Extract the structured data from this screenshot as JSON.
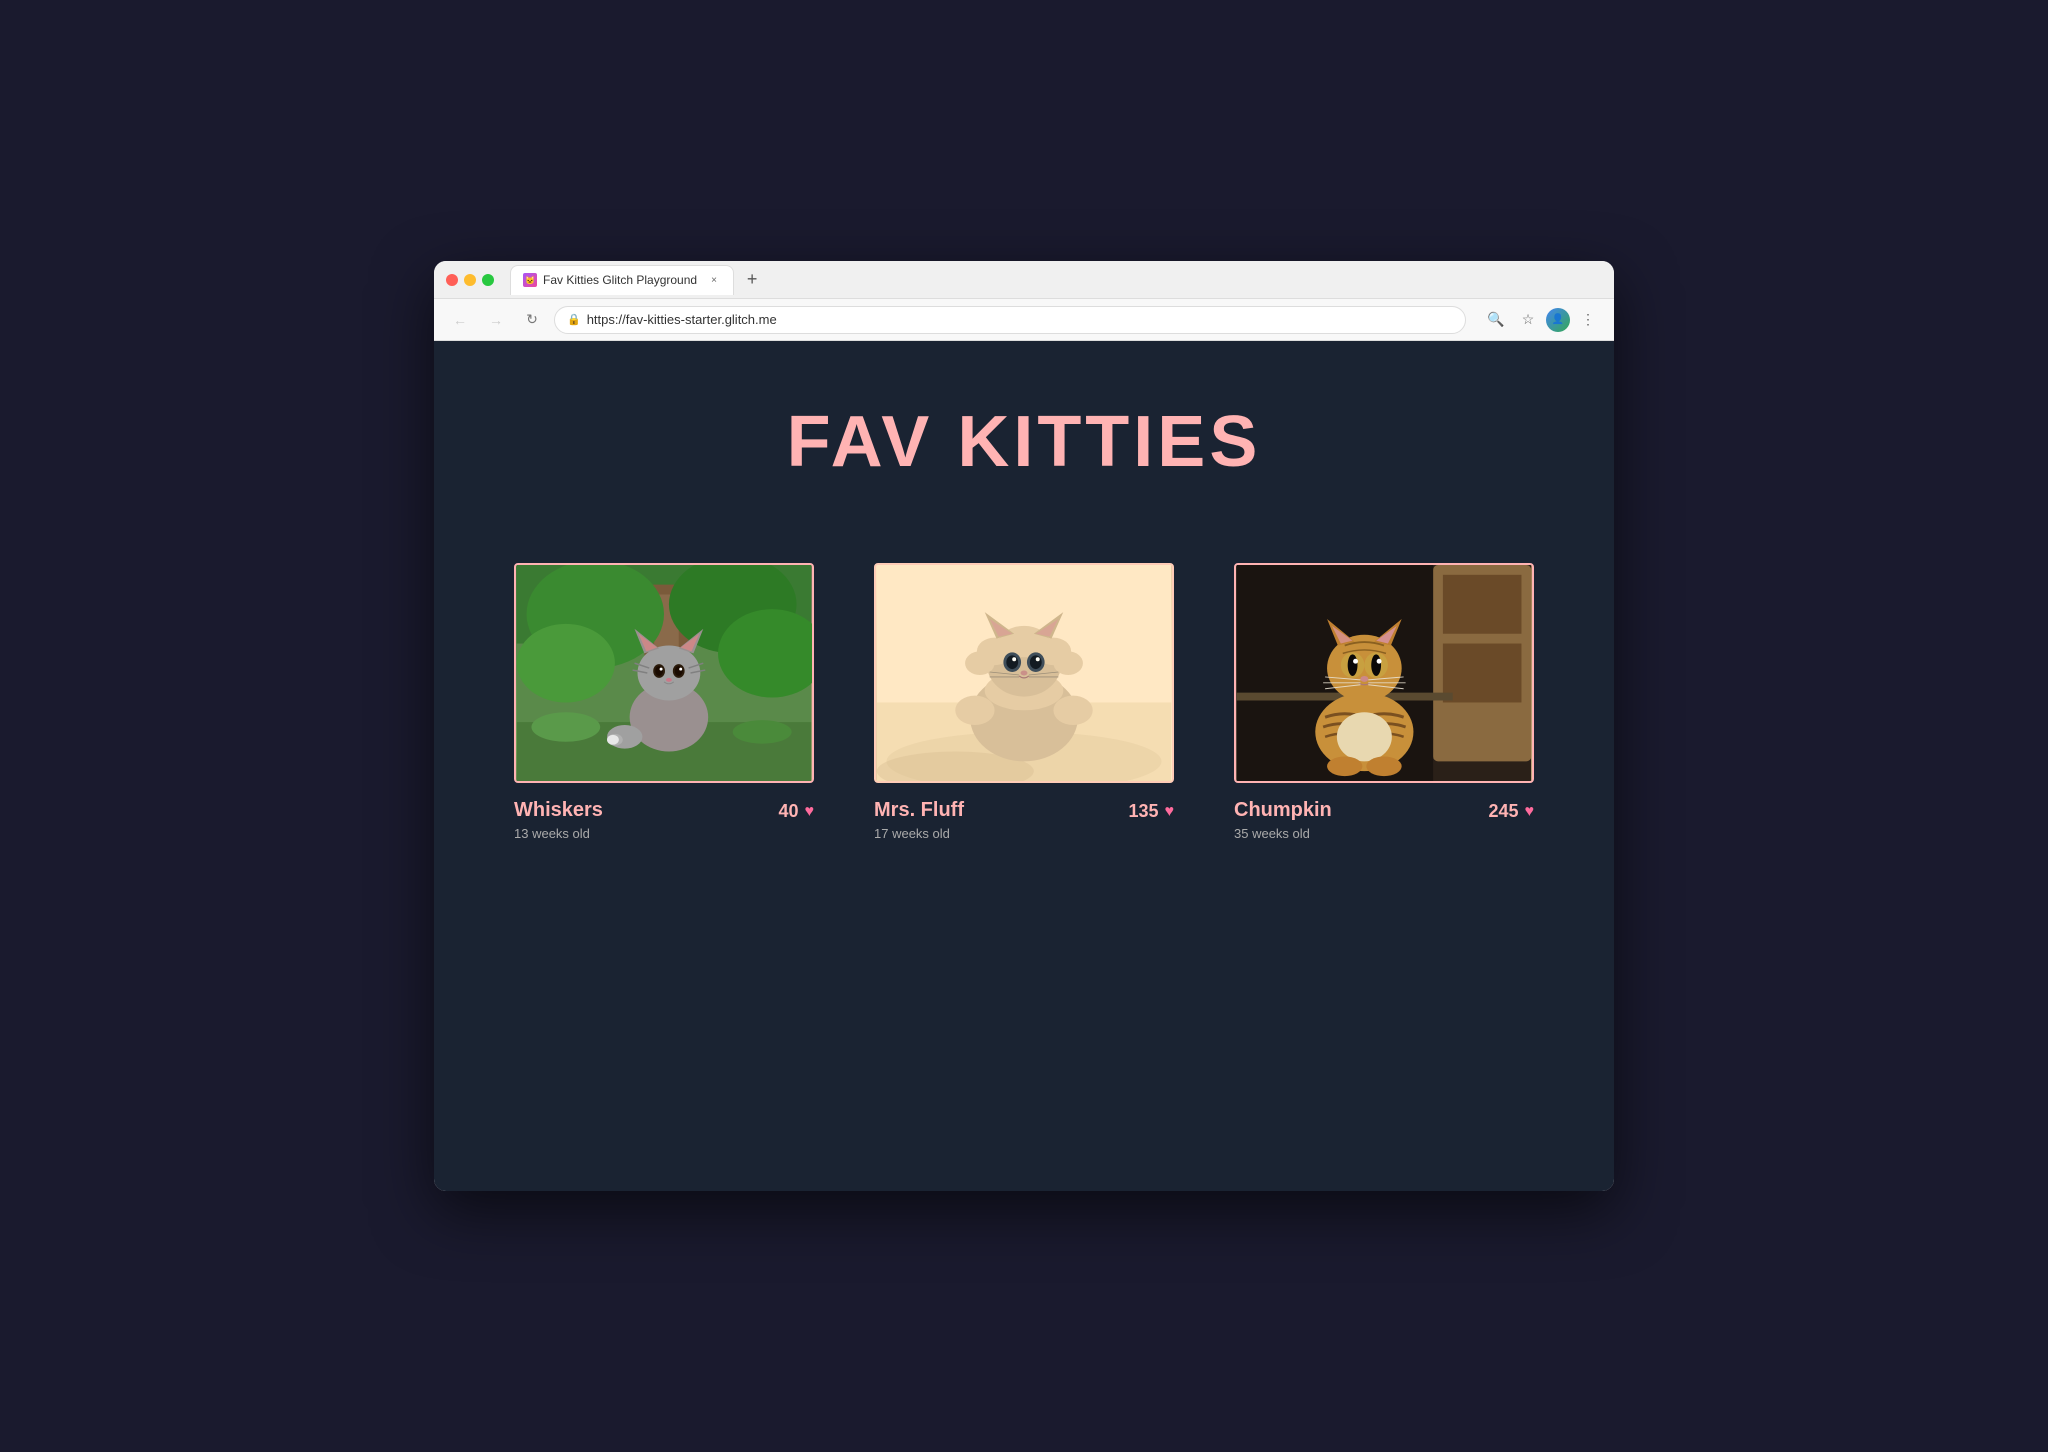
{
  "browser": {
    "tab_title": "Fav Kitties Glitch Playground",
    "tab_close": "×",
    "tab_new": "+",
    "url": "https://fav-kitties-starter.glitch.me",
    "nav": {
      "back": "←",
      "forward": "→",
      "reload": "↻"
    }
  },
  "site": {
    "title": "FAV KITTIES",
    "title_color": "#ffb3b3",
    "background_color": "#1a2332",
    "kitties": [
      {
        "id": "whiskers",
        "name": "Whiskers",
        "age": "13 weeks old",
        "votes": "40",
        "image_type": "outdoor-kitten"
      },
      {
        "id": "mrs-fluff",
        "name": "Mrs. Fluff",
        "age": "17 weeks old",
        "votes": "135",
        "image_type": "fluffy-kitten"
      },
      {
        "id": "chumpkin",
        "name": "Chumpkin",
        "age": "35 weeks old",
        "votes": "245",
        "image_type": "adult-tabby"
      }
    ]
  }
}
